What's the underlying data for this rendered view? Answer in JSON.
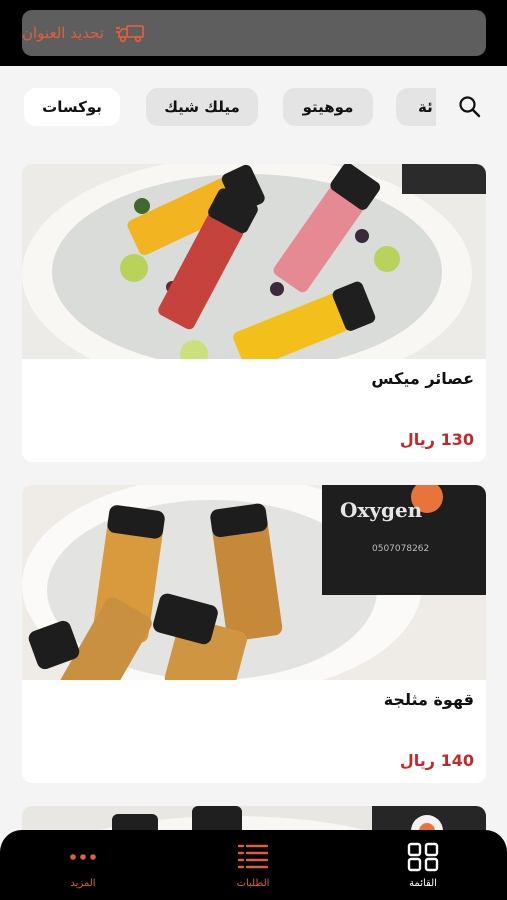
{
  "header": {
    "address_label": "تحديد العنوان",
    "icon": "truck-icon"
  },
  "categories": {
    "search_icon": "search-icon",
    "items": [
      {
        "label": "ئة",
        "partial": true
      },
      {
        "label": "موهيتو"
      },
      {
        "label": "ميلك شيك"
      },
      {
        "label": "بوكسات",
        "active": true
      }
    ]
  },
  "products": [
    {
      "name": "عصائر ميكس",
      "price": "130 ريال"
    },
    {
      "name": "قهوة مثلجة",
      "price": "140 ريال"
    }
  ],
  "bottom_nav": {
    "items": [
      {
        "label": "القائمة",
        "icon": "grid-icon",
        "active": true
      },
      {
        "label": "الطلبات",
        "icon": "list-icon"
      },
      {
        "label": "المزيد",
        "icon": "more-icon"
      }
    ]
  },
  "colors": {
    "accent": "#e05f3a",
    "price": "#c62828",
    "topbar": "#000000",
    "address_button": "#5e5e5e"
  }
}
